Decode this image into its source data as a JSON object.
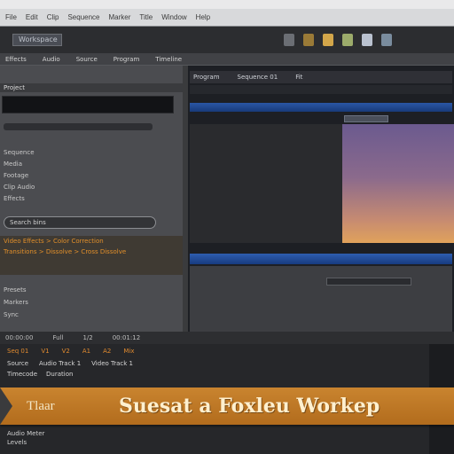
{
  "menubar": {
    "items": [
      "File",
      "Edit",
      "Clip",
      "Sequence",
      "Marker",
      "Title",
      "Window",
      "Help"
    ]
  },
  "toolbar": {
    "app_title": "Workspace"
  },
  "tabs": [
    "Effects",
    "Audio",
    "Source",
    "Program",
    "Timeline"
  ],
  "left_panel": {
    "header": "Project",
    "list_items": [
      "Sequence",
      "Media",
      "Footage",
      "Clip Audio",
      "Effects"
    ],
    "pill_label": "Search bins",
    "orange_lines": [
      "Video Effects > Color Correction",
      "Transitions > Dissolve > Cross Dissolve"
    ],
    "lower_items": [
      "Presets",
      "Markers",
      "Sync"
    ]
  },
  "right_panel": {
    "top_bar": [
      "Program",
      "Sequence 01",
      "Fit"
    ]
  },
  "status": {
    "items": [
      "00:00:00",
      "Full",
      "1/2",
      "00:01:12"
    ]
  },
  "bottom_panel": {
    "row1": [
      "Seq 01",
      "V1",
      "V2",
      "A1",
      "A2",
      "Mix"
    ],
    "row2": [
      "Source",
      "Audio Track 1",
      "Video Track 1"
    ],
    "row3": [
      "Timecode",
      "Duration"
    ],
    "footer": [
      "Audio Meter",
      "Levels"
    ]
  },
  "banner": {
    "left": "Tlaar",
    "right": "Suesat a Foxleu Workep"
  },
  "colors": {
    "accent_orange": "#c9842f",
    "accent_blue": "#2a56a5"
  }
}
